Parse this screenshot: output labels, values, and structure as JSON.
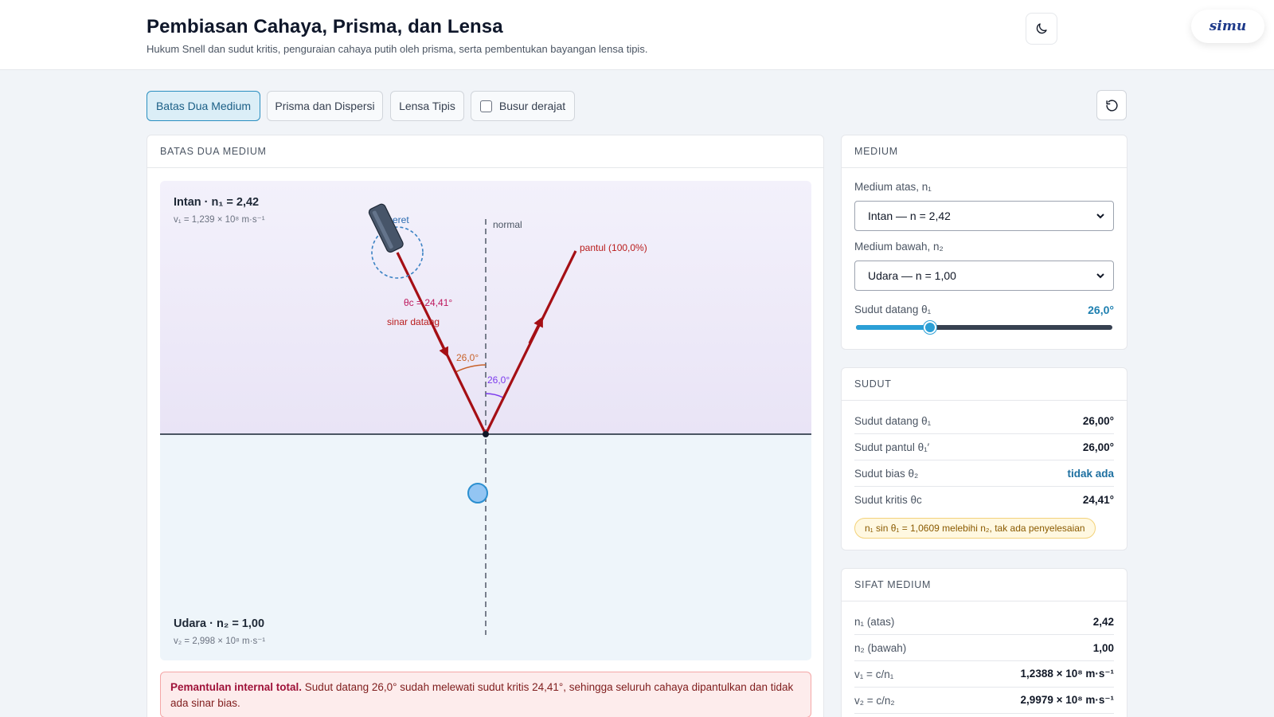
{
  "header": {
    "title": "Pembiasan Cahaya, Prisma, dan Lensa",
    "subtitle": "Hukum Snell dan sudut kritis, penguraian cahaya putih oleh prisma, serta pembentukan bayangan lensa tipis.",
    "logo": "simu",
    "theme_icon": "moon-icon"
  },
  "toolbar": {
    "tabs": [
      "Batas Dua Medium",
      "Prisma dan Dispersi",
      "Lensa Tipis"
    ],
    "active_tab": "Batas Dua Medium",
    "protractor_label": "Busur derajat",
    "protractor_checked": false,
    "reset_icon": "reset-icon"
  },
  "sim": {
    "title": "BATAS DUA MEDIUM",
    "upper_medium_label": "Intan · n₁ = 2,42",
    "upper_velocity": "v₁ = 1,239 × 10⁸ m·s⁻¹",
    "lower_medium_label": "Udara · n₂ = 1,00",
    "lower_velocity": "v₂ = 2,998 × 10⁸ m·s⁻¹",
    "drag_label": "seret",
    "normal_label": "normal",
    "reflect_label": "pantul (100,0%)",
    "critical_label": "θc = 24,41°",
    "incident_label": "sinar datang",
    "incident_angle_label": "26,0°",
    "reflect_angle_label": "26,0°",
    "colors": {
      "ray": "#a50f15",
      "upper_bg": "#ede9f8",
      "lower_bg": "#eef5fa",
      "angle_in": "#c8622a",
      "angle_out": "#7c3aed"
    }
  },
  "alert": {
    "title": "Pemantulan internal total.",
    "text": "Sudut datang 26,0° sudah melewati sudut kritis 24,41°, sehingga seluruh cahaya dipantulkan dan tidak ada sinar bias."
  },
  "medium": {
    "title": "MEDIUM",
    "upper_label": "Medium atas, n₁",
    "upper_value": "Intan — n = 2,42",
    "lower_label": "Medium bawah, n₂",
    "lower_value": "Udara — n = 1,00",
    "angle_label": "Sudut datang θ₁",
    "angle_value": "26,0°",
    "angle_fraction": 0.289
  },
  "angles": {
    "title": "SUDUT",
    "rows": [
      {
        "k": "Sudut datang θ₁",
        "v": "26,00°"
      },
      {
        "k": "Sudut pantul θ₁′",
        "v": "26,00°"
      },
      {
        "k": "Sudut bias θ₂",
        "v": "tidak ada"
      },
      {
        "k": "Sudut kritis θc",
        "v": "24,41°"
      }
    ],
    "badge": "n₁ sin θ₁ = 1,0609 melebihi n₂, tak ada penyelesaian"
  },
  "properties": {
    "title": "SIFAT MEDIUM",
    "rows": [
      {
        "k": "n₁ (atas)",
        "v": "2,42"
      },
      {
        "k": "n₂ (bawah)",
        "v": "1,00"
      },
      {
        "k": "v₁ = c/n₁",
        "v": "1,2388 × 10⁸ m·s⁻¹"
      },
      {
        "k": "v₂ = c/n₂",
        "v": "2,9979 × 10⁸ m·s⁻¹"
      }
    ]
  }
}
